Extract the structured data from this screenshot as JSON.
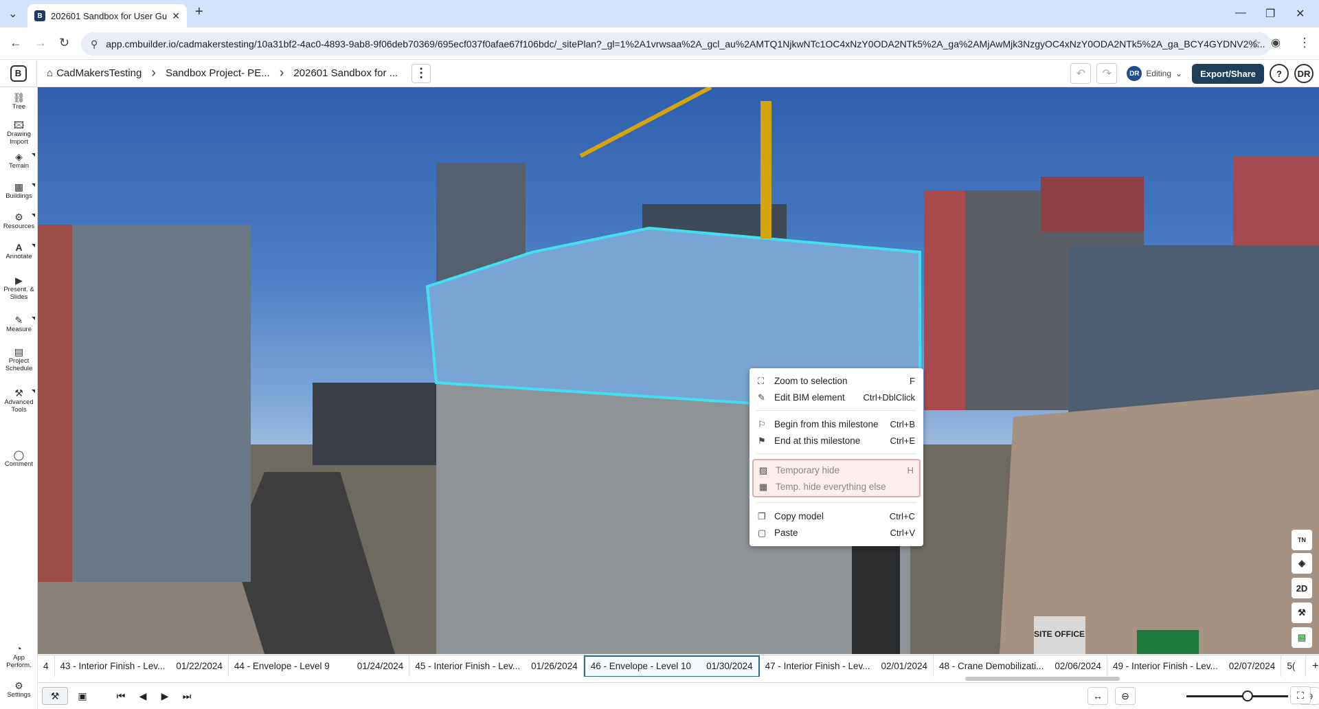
{
  "browser": {
    "tab_title": "202601 Sandbox for User Guide",
    "tab_favicon": "B",
    "url": "app.cmbuilder.io/cadmakerstesting/10a31bf2-4ac0-4893-9ab8-9f06deb70369/695ecf037f0afae67f106bdc/_sitePlan?_gl=1%2A1vrwsaa%2A_gcl_au%2AMTQ1NjkwNTc1OC4xNzY0ODA2NTk5%2A_ga%2AMjAwMjk3NzgyOC4xNzY0ODA2NTk5%2A_ga_BCY4GYDNV2%..."
  },
  "header": {
    "logo": "B",
    "breadcrumbs": [
      "CadMakersTesting",
      "Sandbox Project- PE...",
      "202601 Sandbox for ..."
    ],
    "user_initials": "DR",
    "mode": "Editing",
    "export_label": "Export/Share",
    "help": "?",
    "profile": "DR"
  },
  "sidebar": {
    "items": [
      {
        "label": "Tree",
        "icon": "tree-icon"
      },
      {
        "label": "Drawing Import",
        "icon": "image-icon"
      },
      {
        "label": "Terrain",
        "icon": "layers-icon"
      },
      {
        "label": "Buildings",
        "icon": "building-icon"
      },
      {
        "label": "Resources",
        "icon": "resources-icon"
      },
      {
        "label": "Annotate",
        "icon": "annotate-icon"
      },
      {
        "label": "Present. & Slides",
        "icon": "slides-icon"
      },
      {
        "label": "Measure",
        "icon": "ruler-icon"
      },
      {
        "label": "Project Schedule",
        "icon": "schedule-icon"
      },
      {
        "label": "Advanced Tools",
        "icon": "tools-icon"
      },
      {
        "label": "Comment",
        "icon": "comment-icon"
      }
    ],
    "bottom": [
      {
        "label": "App Perform.",
        "icon": "performance-icon"
      },
      {
        "label": "Settings",
        "icon": "gear-icon"
      }
    ]
  },
  "context_menu": {
    "zoom": {
      "label": "Zoom to selection",
      "shortcut": "F"
    },
    "edit": {
      "label": "Edit BIM element",
      "shortcut": "Ctrl+DblClick"
    },
    "begin": {
      "label": "Begin from this milestone",
      "shortcut": "Ctrl+B"
    },
    "end": {
      "label": "End at this milestone",
      "shortcut": "Ctrl+E"
    },
    "hide": {
      "label": "Temporary hide",
      "shortcut": "H"
    },
    "hide_else": {
      "label": "Temp. hide everything else",
      "shortcut": ""
    },
    "copy": {
      "label": "Copy model",
      "shortcut": "Ctrl+C"
    },
    "paste": {
      "label": "Paste",
      "shortcut": "Ctrl+V"
    }
  },
  "right_tools": {
    "north": "TN",
    "twod": "2D"
  },
  "scene_signs": {
    "site_office": "SITE OFFICE"
  },
  "milestones": [
    {
      "label": "4",
      "date": ""
    },
    {
      "label": "43 - Interior Finish - Lev...",
      "date": "01/22/2024"
    },
    {
      "label": "44 - Envelope - Level 9",
      "date": "01/24/2024"
    },
    {
      "label": "45 - Interior Finish - Lev...",
      "date": "01/26/2024"
    },
    {
      "label": "46 - Envelope - Level 10",
      "date": "01/30/2024"
    },
    {
      "label": "47 - Interior Finish - Lev...",
      "date": "02/01/2024"
    },
    {
      "label": "48 - Crane Demobilizati...",
      "date": "02/06/2024"
    },
    {
      "label": "49 - Interior Finish - Lev...",
      "date": "02/07/2024"
    },
    {
      "label": "5(",
      "date": ""
    }
  ],
  "zoom_level": 0.6
}
